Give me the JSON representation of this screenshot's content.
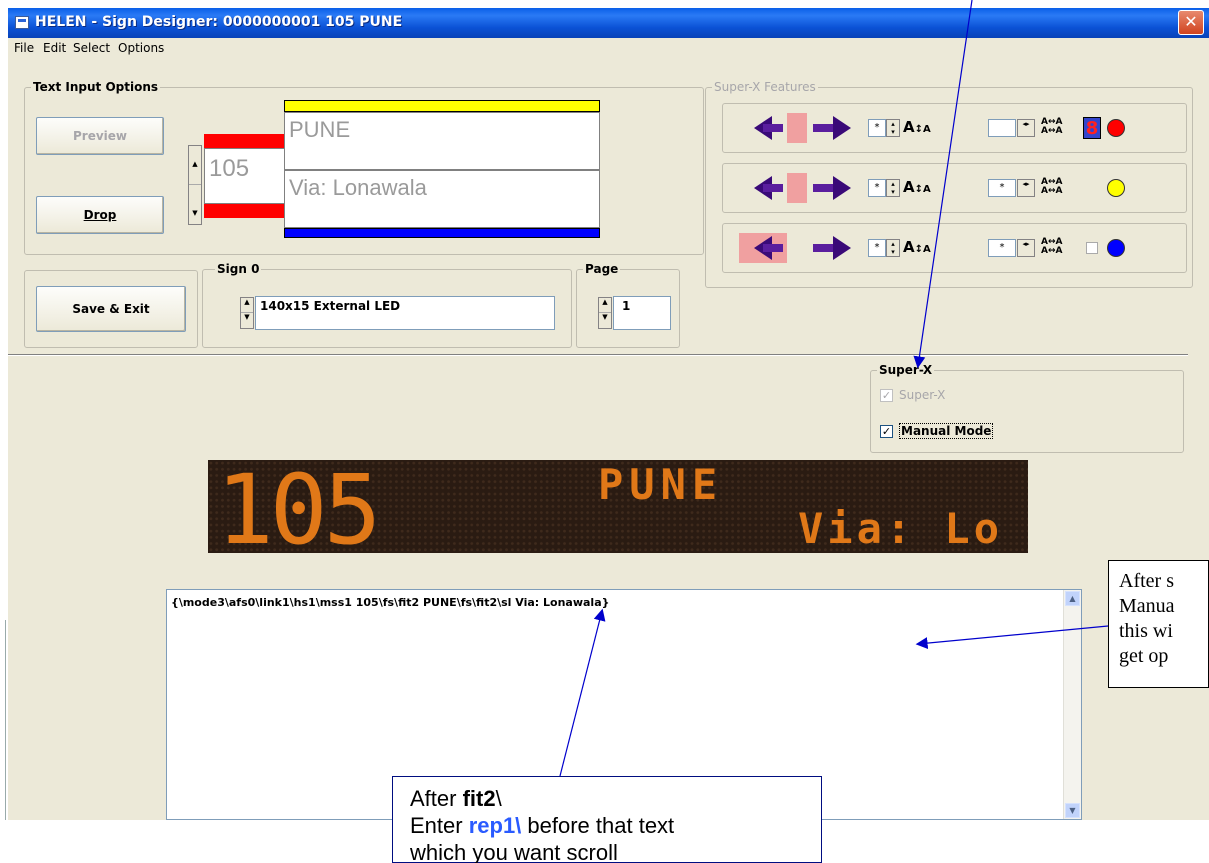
{
  "window": {
    "title": "HELEN - Sign Designer: 0000000001 105 PUNE",
    "close_symbol": "✕"
  },
  "menu": [
    "File",
    "Edit",
    "Select",
    "Options"
  ],
  "text_input": {
    "legend": "Text Input Options",
    "preview_label": "Preview",
    "drop_label": "Drop",
    "route_number": "105",
    "line1": "PUNE",
    "line2": "Via: Lonawala"
  },
  "super_x_features": {
    "legend": "Super-X Features",
    "rows": [
      {
        "scroll_value": "*",
        "spacing_value": "",
        "indicator_color": "#ff0000",
        "has_digit_icon": true,
        "digit": "8",
        "has_checkbox": false
      },
      {
        "scroll_value": "*",
        "spacing_value": "*",
        "indicator_color": "#ffff00",
        "has_digit_icon": false,
        "has_checkbox": false
      },
      {
        "scroll_value": "*",
        "spacing_value": "*",
        "indicator_color": "#0000ff",
        "has_digit_icon": false,
        "has_checkbox": true
      }
    ]
  },
  "save_exit_label": "Save & Exit",
  "sign": {
    "legend": "Sign 0",
    "value": "140x15 External LED"
  },
  "page": {
    "legend": "Page",
    "value": "1"
  },
  "super_x": {
    "legend": "Super-X",
    "super_x_label": "Super-X",
    "super_x_checked": true,
    "manual_mode_label": "Manual Mode",
    "manual_mode_checked": true
  },
  "led_display": {
    "route": "105",
    "line1": "PUNE",
    "line2": "Via: Lo"
  },
  "code_text": "{\\mode3\\afs0\\link1\\hs1\\mss1 105\\fs\\fit2 PUNE\\fs\\fit2\\sl Via: Lonawala}",
  "callout_right": {
    "lines": [
      "After s",
      "Manua",
      "this wi",
      "get op"
    ]
  },
  "callout_bottom": {
    "line1_prefix": "After ",
    "line1_bold": "fit2",
    "line1_suffix": "\\",
    "line2_prefix": "Enter ",
    "line2_blue": "rep1\\",
    "line2_suffix": " before that text",
    "line3": "which you want scroll"
  },
  "colors": {
    "title_bar": "#0a5fe8",
    "window_bg": "#ece9d8",
    "yellow_bar": "#ffff00",
    "blue_bar": "#0000ff",
    "red_bar": "#ff0000",
    "led_text": "#e07818",
    "arrow_purple": "#3a0a78",
    "pink": "#f0a0a0"
  }
}
